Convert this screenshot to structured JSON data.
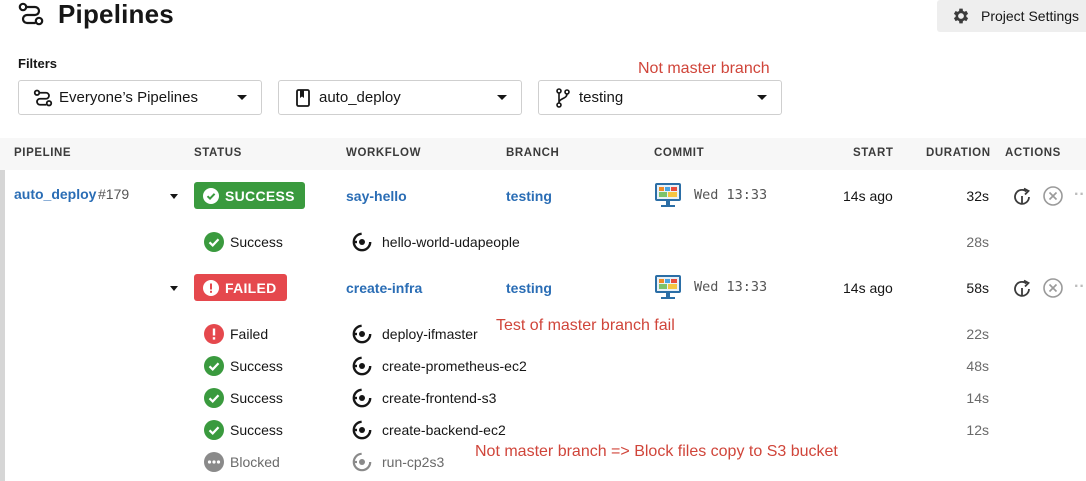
{
  "header": {
    "title": "Pipelines",
    "project_settings_label": "Project Settings"
  },
  "filters": {
    "label": "Filters",
    "pipelines_scope": "Everyone’s Pipelines",
    "project": "auto_deploy",
    "branch": "testing"
  },
  "notes": {
    "branch_note": "Not master branch",
    "fail_note": "Test of master branch fail",
    "block_note": "Not master branch => Block files copy to S3 bucket"
  },
  "table": {
    "headers": [
      "PIPELINE",
      "STATUS",
      "WORKFLOW",
      "BRANCH",
      "COMMIT",
      "START",
      "DURATION",
      "ACTIONS"
    ]
  },
  "pipeline": {
    "name": "auto_deploy",
    "number": "#179"
  },
  "workflows": [
    {
      "status": "SUCCESS",
      "name": "say-hello",
      "branch": "testing",
      "commit_time": "Wed 13:33",
      "start": "14s ago",
      "duration": "32s",
      "jobs": [
        {
          "status": "Success",
          "name": "hello-world-udapeople",
          "duration": "28s"
        }
      ]
    },
    {
      "status": "FAILED",
      "name": "create-infra",
      "branch": "testing",
      "commit_time": "Wed 13:33",
      "start": "14s ago",
      "duration": "58s",
      "jobs": [
        {
          "status": "Failed",
          "name": "deploy-ifmaster",
          "duration": "22s"
        },
        {
          "status": "Success",
          "name": "create-prometheus-ec2",
          "duration": "48s"
        },
        {
          "status": "Success",
          "name": "create-frontend-s3",
          "duration": "14s"
        },
        {
          "status": "Success",
          "name": "create-backend-ec2",
          "duration": "12s"
        },
        {
          "status": "Blocked",
          "name": "run-cp2s3",
          "duration": ""
        }
      ]
    }
  ],
  "colors": {
    "success": "#3a9a3e",
    "failed": "#e5484d",
    "blocked": "#8a8a8a",
    "link": "#2a6db5",
    "annotation": "#d0453a"
  },
  "icons": {
    "title": "pipelines-icon",
    "settings": "gear-icon",
    "rerun": "rerun-icon",
    "cancel": "cancel-icon",
    "job": "job-icon"
  }
}
